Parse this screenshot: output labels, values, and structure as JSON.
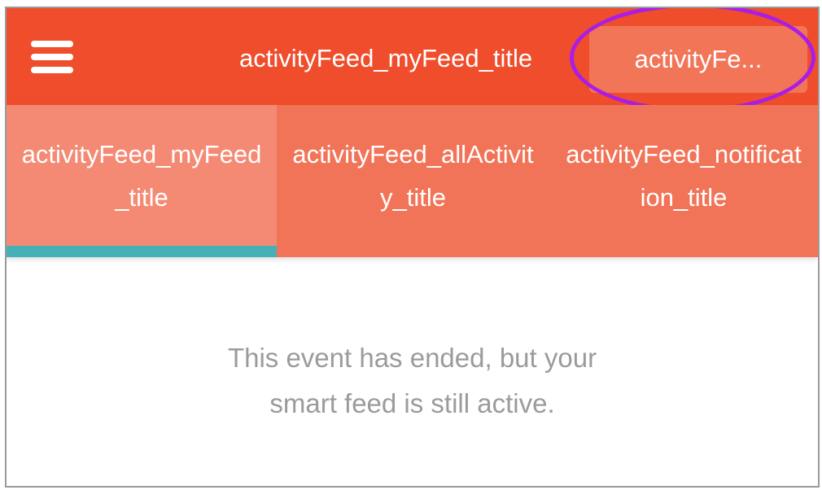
{
  "header": {
    "menu_icon": "hamburger-menu-icon",
    "title": "activityFeed_myFeed_title",
    "right_button_label": "activityFe...",
    "highlight_color": "#a81ee6",
    "background_color": "#ef4d2b"
  },
  "tabs": {
    "active_index": 0,
    "indicator_color": "#45b1b7",
    "items": [
      {
        "label": "activityFeed_myFeed_title"
      },
      {
        "label": "activityFeed_allActivity_title"
      },
      {
        "label": "activityFeed_notification_title"
      }
    ]
  },
  "content": {
    "message_line1": "This event has ended, but your",
    "message_line2": "smart feed is still active."
  }
}
